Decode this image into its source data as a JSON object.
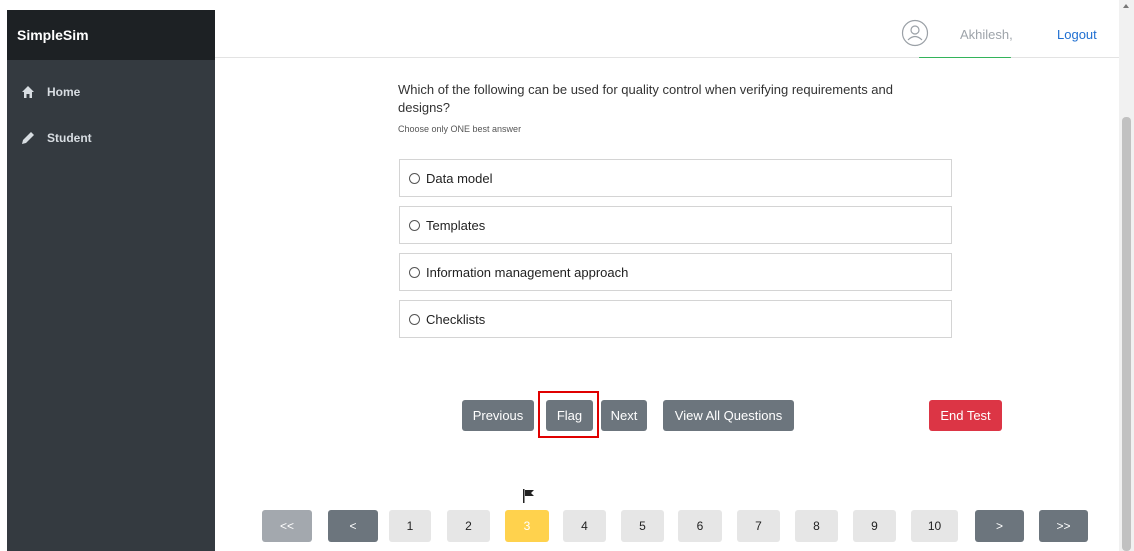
{
  "sidebar": {
    "brand": "SimpleSim",
    "items": [
      {
        "label": "Home",
        "icon": "home-icon"
      },
      {
        "label": "Student",
        "icon": "pencil-icon"
      }
    ]
  },
  "header": {
    "username": "Akhilesh,",
    "logout_label": "Logout",
    "avatar_icon": "user-avatar-icon"
  },
  "question": {
    "text": "Which of the following can be used for quality control when verifying requirements and designs?",
    "hint": "Choose only ONE best answer",
    "options": [
      "Data model",
      "Templates",
      "Information management approach",
      "Checklists"
    ]
  },
  "actions": {
    "previous": "Previous",
    "flag": "Flag",
    "next": "Next",
    "view_all": "View All Questions",
    "end_test": "End Test"
  },
  "pagination": {
    "first": "<<",
    "prev": "<",
    "pages": [
      "1",
      "2",
      "3",
      "4",
      "5",
      "6",
      "7",
      "8",
      "9",
      "10"
    ],
    "current_page": "3",
    "flagged_page": "3",
    "next": ">",
    "last": ">>"
  },
  "colors": {
    "sidebar_bg": "#343a40",
    "brand_bg": "#1d2124",
    "button_gray": "#6c757d",
    "button_red": "#dc3545",
    "current_page": "#ffd24d",
    "link_blue": "#1f6fd1",
    "highlight_outline": "#e00000"
  }
}
